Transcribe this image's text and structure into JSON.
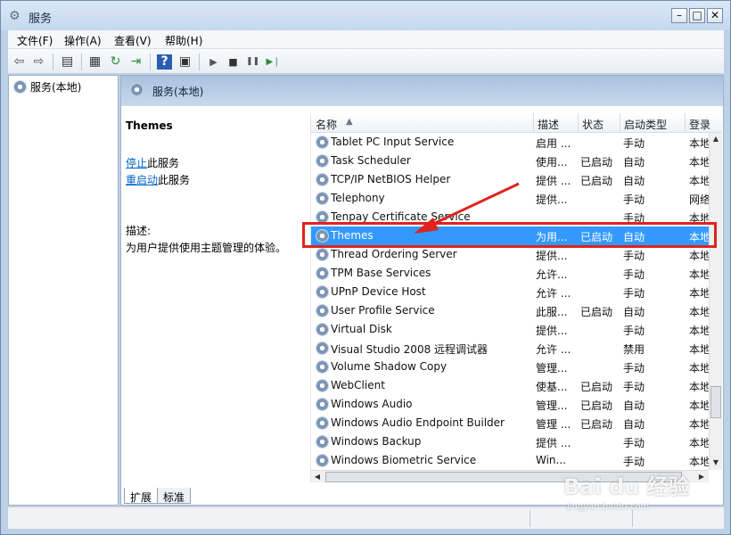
{
  "window": {
    "title": "服务"
  },
  "menubar": [
    {
      "label": "文件(F)"
    },
    {
      "label": "操作(A)"
    },
    {
      "label": "查看(V)"
    },
    {
      "label": "帮助(H)"
    }
  ],
  "toolbar": [
    {
      "icon": "back-arrow-icon",
      "glyph": "⇦"
    },
    {
      "icon": "forward-arrow-icon",
      "glyph": "⇨"
    },
    {
      "icon": "console-tree-icon",
      "glyph": "▤"
    },
    {
      "icon": "properties-icon",
      "glyph": "▦"
    },
    {
      "icon": "refresh-icon",
      "glyph": "↻"
    },
    {
      "icon": "export-list-icon",
      "glyph": "⇥"
    },
    {
      "icon": "help-icon",
      "glyph": "?"
    },
    {
      "icon": "action-pane-icon",
      "glyph": "▣"
    },
    {
      "icon": "start-service-icon",
      "glyph": "▶"
    },
    {
      "icon": "stop-service-icon",
      "glyph": "■"
    },
    {
      "icon": "pause-service-icon",
      "glyph": "❚❚"
    },
    {
      "icon": "restart-service-icon",
      "glyph": "▶❘"
    }
  ],
  "tree": {
    "root": "服务(本地)"
  },
  "main": {
    "header": "服务(本地)"
  },
  "detail": {
    "title": "Themes",
    "stop_link": "停止",
    "stop_suffix": "此服务",
    "restart_link": "重启动",
    "restart_suffix": "此服务",
    "desc_label": "描述:",
    "desc_text": "为用户提供使用主题管理的体验。"
  },
  "columns": {
    "name": "名称",
    "desc": "描述",
    "status": "状态",
    "startup": "启动类型",
    "login": "登录"
  },
  "rows": [
    {
      "name": "Tablet PC Input Service",
      "desc": "启用 ...",
      "status": "",
      "startup": "手动",
      "login": "本地"
    },
    {
      "name": "Task Scheduler",
      "desc": "使用...",
      "status": "已启动",
      "startup": "自动",
      "login": "本地"
    },
    {
      "name": "TCP/IP NetBIOS Helper",
      "desc": "提供 ...",
      "status": "已启动",
      "startup": "自动",
      "login": "本地"
    },
    {
      "name": "Telephony",
      "desc": "提供...",
      "status": "",
      "startup": "手动",
      "login": "网络"
    },
    {
      "name": "Tenpay Certificate Service",
      "desc": "",
      "status": "",
      "startup": "手动",
      "login": "本地"
    },
    {
      "name": "Themes",
      "desc": "为用...",
      "status": "已启动",
      "startup": "自动",
      "login": "本地",
      "selected": true
    },
    {
      "name": "Thread Ordering Server",
      "desc": "提供...",
      "status": "",
      "startup": "手动",
      "login": "本地"
    },
    {
      "name": "TPM Base Services",
      "desc": "允许...",
      "status": "",
      "startup": "手动",
      "login": "本地"
    },
    {
      "name": "UPnP Device Host",
      "desc": "允许 ...",
      "status": "",
      "startup": "手动",
      "login": "本地"
    },
    {
      "name": "User Profile Service",
      "desc": "此服...",
      "status": "已启动",
      "startup": "自动",
      "login": "本地"
    },
    {
      "name": "Virtual Disk",
      "desc": "提供...",
      "status": "",
      "startup": "手动",
      "login": "本地"
    },
    {
      "name": "Visual Studio 2008 远程调试器",
      "desc": "允许 ...",
      "status": "",
      "startup": "禁用",
      "login": "本地"
    },
    {
      "name": "Volume Shadow Copy",
      "desc": "管理...",
      "status": "",
      "startup": "手动",
      "login": "本地"
    },
    {
      "name": "WebClient",
      "desc": "使基...",
      "status": "已启动",
      "startup": "手动",
      "login": "本地"
    },
    {
      "name": "Windows Audio",
      "desc": "管理...",
      "status": "已启动",
      "startup": "自动",
      "login": "本地"
    },
    {
      "name": "Windows Audio Endpoint Builder",
      "desc": "管理 ...",
      "status": "已启动",
      "startup": "自动",
      "login": "本地"
    },
    {
      "name": "Windows Backup",
      "desc": "提供 ...",
      "status": "",
      "startup": "手动",
      "login": "本地"
    },
    {
      "name": "Windows Biometric Service",
      "desc": "Win...",
      "status": "",
      "startup": "手动",
      "login": "本地"
    }
  ],
  "tabs": [
    {
      "label": "扩展"
    },
    {
      "label": "标准"
    }
  ],
  "watermark": {
    "logo": "Bai du 经验",
    "sub": "jingyan.baidu.com"
  },
  "colors": {
    "selection": "#3399ff",
    "annotation": "#e0231d",
    "link": "#0066cc"
  }
}
